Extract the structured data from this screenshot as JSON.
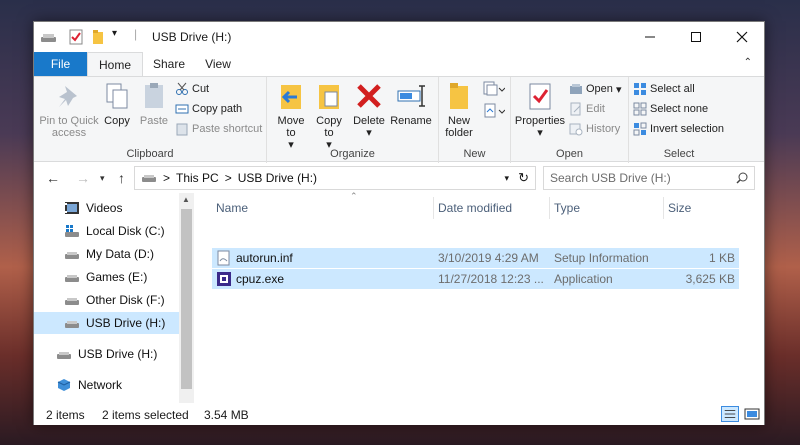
{
  "window": {
    "title": "USB Drive (H:)"
  },
  "ribbon_tabs": {
    "file": "File",
    "home": "Home",
    "share": "Share",
    "view": "View"
  },
  "clipboard": {
    "pin": "Pin to Quick access",
    "copy": "Copy",
    "paste": "Paste",
    "cut": "Cut",
    "copy_path": "Copy path",
    "paste_shortcut": "Paste shortcut",
    "label": "Clipboard"
  },
  "organize": {
    "move_to": "Move to",
    "copy_to": "Copy to",
    "delete": "Delete",
    "rename": "Rename",
    "label": "Organize"
  },
  "new_group": {
    "new_folder": "New folder",
    "label": "New"
  },
  "open_group": {
    "properties": "Properties",
    "open": "Open",
    "edit": "Edit",
    "history": "History",
    "label": "Open"
  },
  "select_group": {
    "select_all": "Select all",
    "select_none": "Select none",
    "invert": "Invert selection",
    "label": "Select"
  },
  "address": {
    "this_pc": "This PC",
    "sep": ">",
    "drive": "USB Drive (H:)"
  },
  "search": {
    "placeholder": "Search USB Drive (H:)"
  },
  "nav": {
    "items": [
      {
        "label": "Videos"
      },
      {
        "label": "Local Disk (C:)"
      },
      {
        "label": "My Data (D:)"
      },
      {
        "label": "Games (E:)"
      },
      {
        "label": "Other Disk (F:)"
      },
      {
        "label": "USB Drive (H:)"
      },
      {
        "label": "USB Drive (H:)"
      },
      {
        "label": "Network"
      }
    ]
  },
  "columns": {
    "name": "Name",
    "date": "Date modified",
    "type": "Type",
    "size": "Size"
  },
  "files": [
    {
      "name": "autorun.inf",
      "date": "3/10/2019 4:29 AM",
      "type": "Setup Information",
      "size": "1 KB"
    },
    {
      "name": "cpuz.exe",
      "date": "11/27/2018 12:23 ...",
      "type": "Application",
      "size": "3,625 KB"
    }
  ],
  "status": {
    "count": "2 items",
    "selected": "2 items selected",
    "size": "3.54 MB"
  },
  "colors": {
    "accent": "#1979ca",
    "selection": "#cce8ff"
  }
}
